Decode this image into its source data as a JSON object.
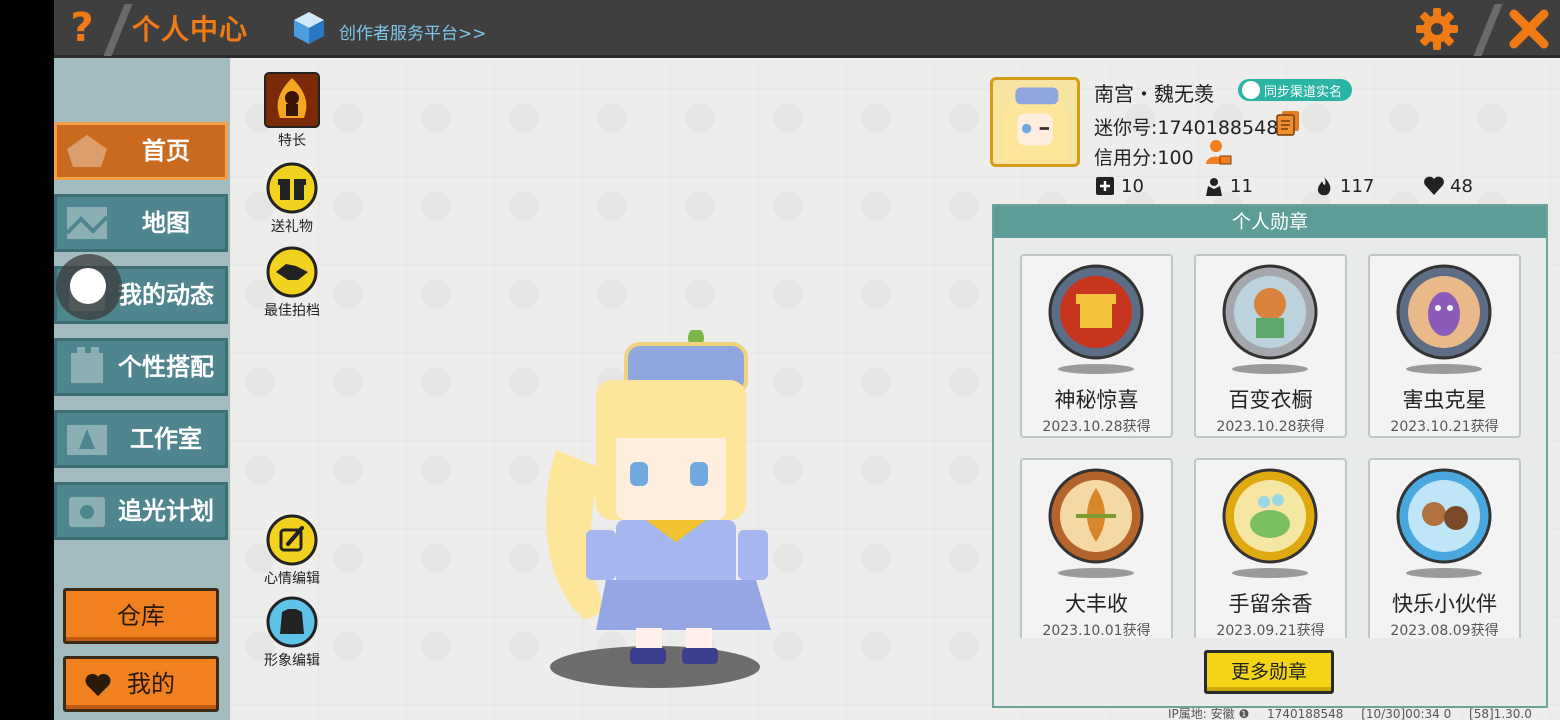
{
  "topbar": {
    "help": "?",
    "title": "个人中心",
    "creator_link": "创作者服务平台>>"
  },
  "nav": {
    "items": [
      {
        "label": "首页",
        "active": true,
        "icon": "home-icon"
      },
      {
        "label": "地图",
        "active": false,
        "icon": "map-icon"
      },
      {
        "label": "我的动态",
        "active": false,
        "icon": "activity-icon"
      },
      {
        "label": "个性搭配",
        "active": false,
        "icon": "outfit-icon"
      },
      {
        "label": "工作室",
        "active": false,
        "icon": "studio-icon"
      },
      {
        "label": "追光计划",
        "active": false,
        "icon": "plan-icon"
      }
    ],
    "warehouse": "仓库",
    "mine": "我的"
  },
  "tools": {
    "skill": "特长",
    "gift": "送礼物",
    "best_shot": "最佳拍档",
    "mood_edit": "心情编辑",
    "avatar_edit": "形象编辑"
  },
  "profile": {
    "name": "南宫・魏无羡",
    "sync_badge": "同步渠道实名",
    "mini_id": "迷你号:1740188548",
    "credit": "信用分:100",
    "stats": {
      "add": "10",
      "followers": "11",
      "fire": "117",
      "likes": "48"
    }
  },
  "medals": {
    "title": "个人勋章",
    "items": [
      {
        "name": "神秘惊喜",
        "date": "2023.10.28获得",
        "color": "#c7351f"
      },
      {
        "name": "百变衣橱",
        "date": "2023.10.28获得",
        "color": "#8fb5c4"
      },
      {
        "name": "害虫克星",
        "date": "2023.10.21获得",
        "color": "#8a5bb8"
      },
      {
        "name": "大丰收",
        "date": "2023.10.01获得",
        "color": "#d8862a"
      },
      {
        "name": "手留余香",
        "date": "2023.09.21获得",
        "color": "#7cbf63"
      },
      {
        "name": "快乐小伙伴",
        "date": "2023.08.09获得",
        "color": "#4aa8de"
      }
    ],
    "more_button": "更多勋章"
  },
  "footer": {
    "ip": "IP属地: 安徽 ❶",
    "uid": "1740188548",
    "time": "[10/30]00:34 0",
    "version": "[58]1.30.0"
  },
  "colors": {
    "accent_orange": "#f07a14",
    "nav_teal": "#4f858e",
    "active_nav": "#ca6a1f",
    "medal_header": "#5e9d97",
    "yellow_button": "#f3d417"
  }
}
